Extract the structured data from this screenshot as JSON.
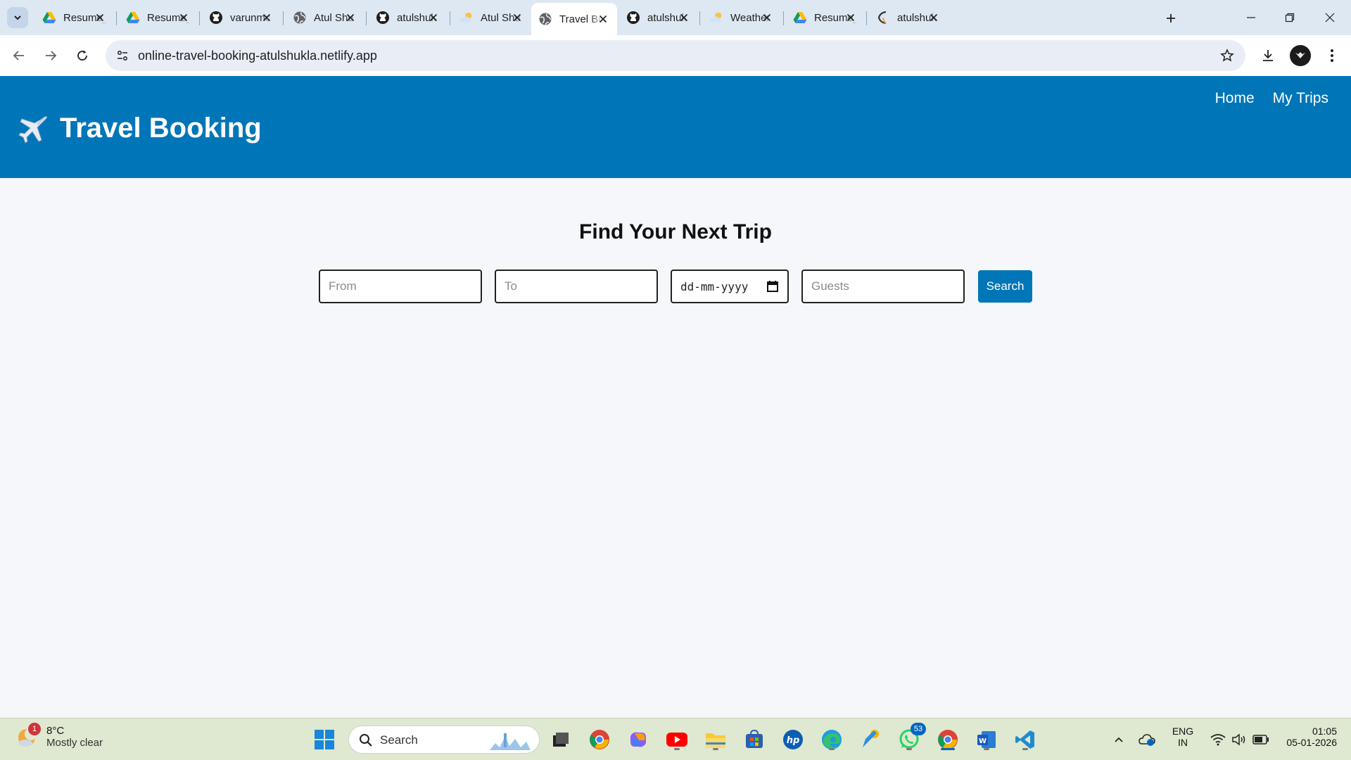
{
  "browser": {
    "tabs": [
      {
        "title": "Resume_",
        "favicon": "google-drive-icon",
        "active": false
      },
      {
        "title": "Resume_",
        "favicon": "google-drive-icon",
        "active": false
      },
      {
        "title": "varunmc",
        "favicon": "github-icon",
        "active": false
      },
      {
        "title": "Atul Shu",
        "favicon": "globe-icon",
        "active": false
      },
      {
        "title": "atulshuk",
        "favicon": "github-icon",
        "active": false
      },
      {
        "title": "Atul Shu",
        "favicon": "weather-cloud-icon",
        "active": false
      },
      {
        "title": "Travel Bo",
        "favicon": "globe-icon",
        "active": true
      },
      {
        "title": "atulshuk",
        "favicon": "github-icon",
        "active": false
      },
      {
        "title": "Weather",
        "favicon": "weather-cloud-icon",
        "active": false
      },
      {
        "title": "Resume_",
        "favicon": "google-drive-icon",
        "active": false
      },
      {
        "title": "atulshuk",
        "favicon": "netlify-icon",
        "active": false
      }
    ],
    "url": "online-travel-booking-atulshukla.netlify.app"
  },
  "page": {
    "brand_title": "Travel Booking",
    "nav": {
      "home": "Home",
      "my_trips": "My Trips"
    },
    "search": {
      "heading": "Find Your Next Trip",
      "from_placeholder": "From",
      "to_placeholder": "To",
      "date_placeholder": "dd-mm-yyyy",
      "guests_placeholder": "Guests",
      "button_label": "Search"
    }
  },
  "taskbar": {
    "weather": {
      "temp": "8°C",
      "desc": "Mostly clear",
      "badge": "1"
    },
    "search_label": "Search",
    "whatsapp_badge": "53",
    "language": {
      "line1": "ENG",
      "line2": "IN"
    },
    "time": "01:05",
    "date": "05-01-2026"
  },
  "colors": {
    "header_bg": "#0076b8",
    "button_bg": "#0076b8",
    "page_bg": "#f5f7fa",
    "taskbar_bg": "#dfe8d0"
  }
}
